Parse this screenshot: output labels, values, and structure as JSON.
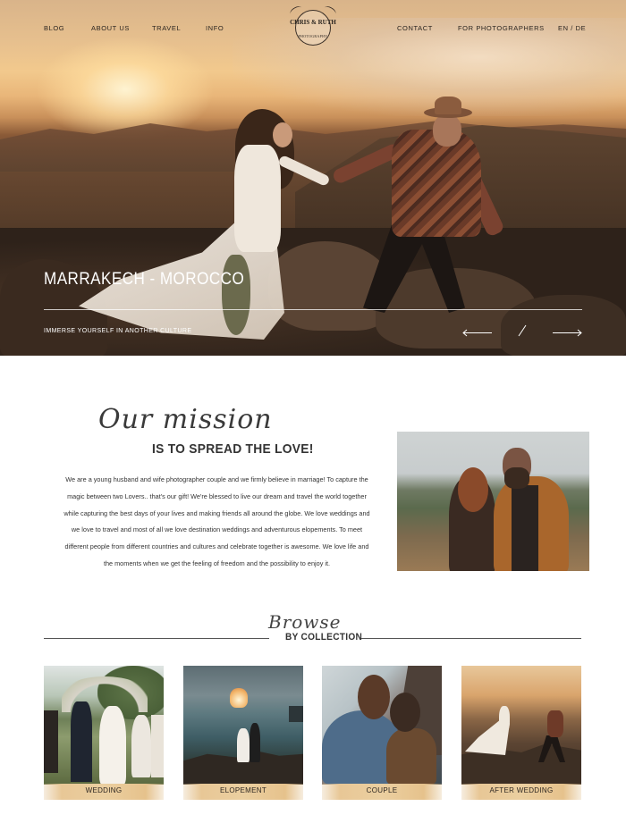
{
  "nav": {
    "left": [
      "BLOG",
      "ABOUT US",
      "TRAVEL",
      "INFO"
    ],
    "right": [
      "CONTACT",
      "FOR PHOTOGRAPHERS",
      "EN / DE"
    ]
  },
  "logo": {
    "name": "CHRIS & RUTH",
    "sub": "PHOTOGRAPHY"
  },
  "hero": {
    "title": "MARRAKECH - MOROCCO",
    "subtitle": "IMMERSE YOURSELF IN ANOTHER CULTURE"
  },
  "mission": {
    "script": "Our mission",
    "heading": "IS TO SPREAD THE LOVE!",
    "body": "We are a young husband and wife photographer couple and we firmly believe in marriage! To capture the magic between two Lovers.. that's our gift! We're blessed to live our dream and travel the world together while capturing the best days of your lives and making friends all around the globe. We love weddings and we love to travel and most of all we love destination weddings and adventurous elopements. To meet different people from different countries and cultures and celebrate together is awesome. We love life and the moments when we get the feeling of freedom and the possibility to enjoy it."
  },
  "browse": {
    "script": "Browse",
    "heading": "BY COLLECTION",
    "collections": [
      {
        "label": "WEDDING"
      },
      {
        "label": "ELOPEMENT"
      },
      {
        "label": "COUPLE"
      },
      {
        "label": "AFTER WEDDING"
      }
    ]
  },
  "icons": {
    "prev": "arrow-left-icon",
    "next": "arrow-right-icon",
    "slash": "divider-slash-icon"
  },
  "colors": {
    "accent_band": "#e8c796",
    "text": "#333333",
    "hero_text": "#ffffff"
  }
}
